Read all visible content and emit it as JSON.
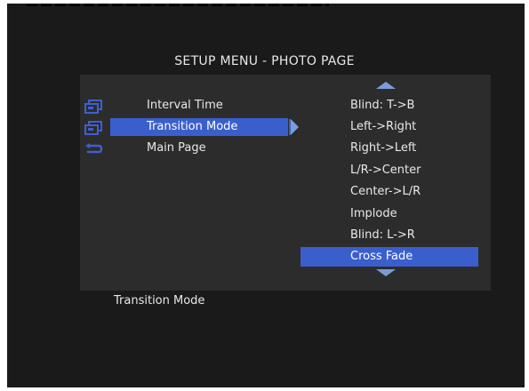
{
  "title": "SETUP MENU - PHOTO PAGE",
  "left_menu": {
    "items": [
      {
        "label": "Interval Time",
        "icon": "monitor-icon",
        "selected": false
      },
      {
        "label": "Transition Mode",
        "icon": "monitor-icon",
        "selected": true
      },
      {
        "label": "Main Page",
        "icon": "return-arrow-icon",
        "selected": false
      }
    ]
  },
  "options": {
    "items": [
      {
        "label": "Blind: T->B",
        "selected": false
      },
      {
        "label": "Left->Right",
        "selected": false
      },
      {
        "label": "Right->Left",
        "selected": false
      },
      {
        "label": "L/R->Center",
        "selected": false
      },
      {
        "label": "Center->L/R",
        "selected": false
      },
      {
        "label": "Implode",
        "selected": false
      },
      {
        "label": "Blind: L->R",
        "selected": false
      },
      {
        "label": "Cross Fade",
        "selected": true
      }
    ],
    "scroll_up_icon": "triangle-up-icon",
    "scroll_down_icon": "triangle-down-icon"
  },
  "status_text": "Transition Mode",
  "colors": {
    "highlight": "#3a5fcd",
    "icon": "#3f5fcf",
    "arrow": "#7a9cd8",
    "panel": "#2c2c2c",
    "background": "#1a1a1a"
  }
}
